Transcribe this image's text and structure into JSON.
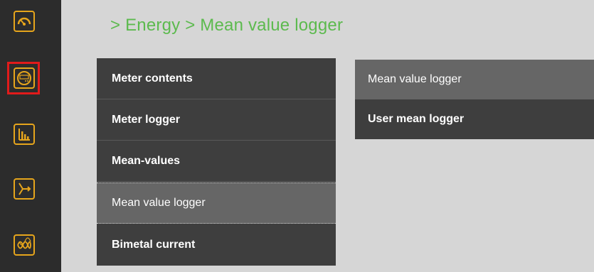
{
  "breadcrumb": "> Energy > Mean value logger",
  "rail": {
    "items": [
      {
        "icon": "gauge-icon"
      },
      {
        "icon": "energy-meter-icon",
        "selected": true
      },
      {
        "icon": "bar-chart-icon"
      },
      {
        "icon": "vector-diagram-icon"
      },
      {
        "icon": "waveform-icon"
      }
    ]
  },
  "menu": {
    "items": [
      {
        "label": "Meter contents"
      },
      {
        "label": "Meter logger"
      },
      {
        "label": "Mean-values"
      },
      {
        "label": "Mean value logger",
        "active": true
      },
      {
        "label": "Bimetal current"
      }
    ]
  },
  "submenu": {
    "items": [
      {
        "label": "Mean value logger",
        "active": true
      },
      {
        "label": "User mean logger"
      }
    ]
  },
  "colors": {
    "accent_green": "#5cba4e",
    "icon_orange": "#e6a51c",
    "selection_red": "#e11b1b",
    "panel_dark": "#3e3e3e",
    "panel_active": "#666666"
  }
}
